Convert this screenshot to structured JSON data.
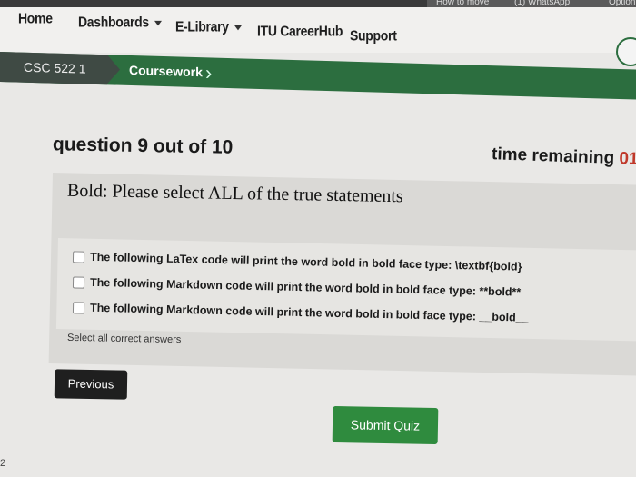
{
  "browser_tabs": [
    "How to move d...",
    "(1) WhatsApp",
    "Option"
  ],
  "nav": {
    "items": [
      {
        "label": "Home",
        "has_dropdown": false
      },
      {
        "label": "Dashboards",
        "has_dropdown": true
      },
      {
        "label": "E-Library",
        "has_dropdown": true
      },
      {
        "label": "ITU CareerHub",
        "has_dropdown": false
      },
      {
        "label": "Support",
        "has_dropdown": false
      }
    ]
  },
  "breadcrumb": {
    "course": "CSC 522 1",
    "section": "Coursework"
  },
  "quiz": {
    "progress": "question 9 out of 10",
    "time_label": "time remaining",
    "time_value": "01",
    "question": "Bold: Please select ALL of the true statements",
    "options": [
      {
        "text": "The following LaTex code will print the word bold in bold face type: \\textbf{bold}",
        "checked": false
      },
      {
        "text": "The following Markdown code will print the word bold in bold face type: **bold**",
        "checked": false
      },
      {
        "text": "The following Markdown code will print the word bold in bold face type: __bold__",
        "checked": false
      }
    ],
    "hint": "Select all correct answers",
    "prev_label": "Previous",
    "submit_label": "Submit Quiz"
  },
  "page_number": "2",
  "colors": {
    "nav_green": "#2c6e3f",
    "submit_green": "#2f8b3e",
    "prev_dark": "#1f1f1f"
  }
}
